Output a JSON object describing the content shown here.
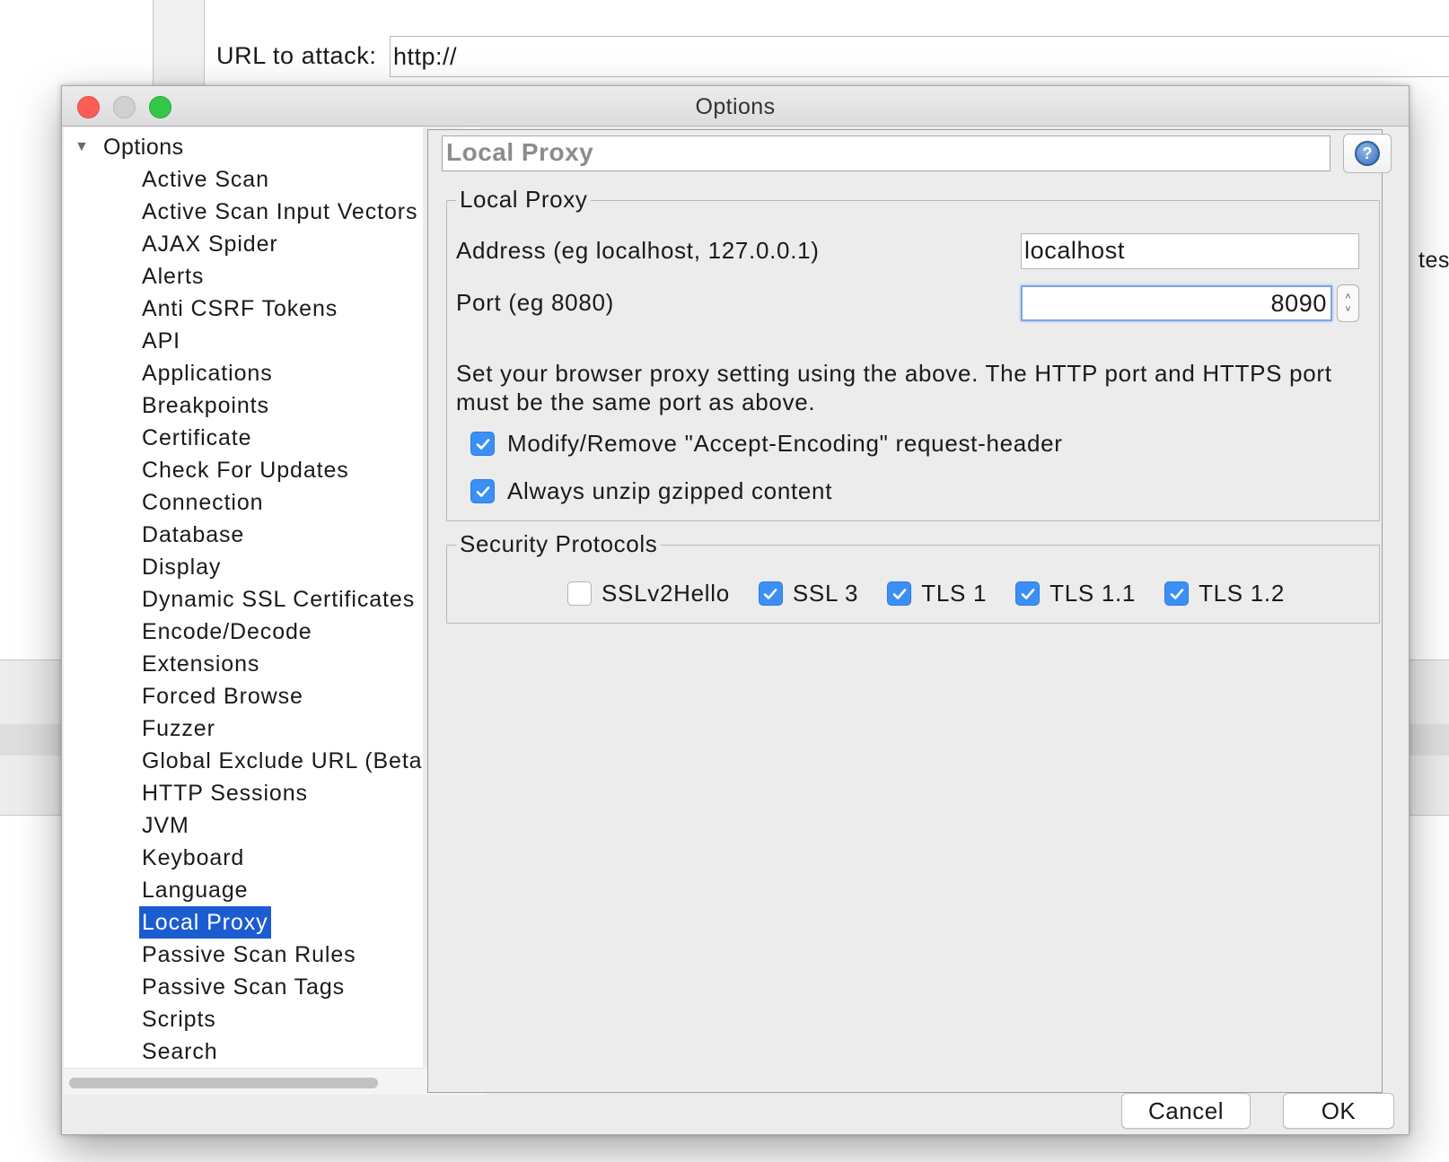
{
  "background": {
    "url_label": "URL to attack:",
    "url_value": "http://",
    "side_text": "tes"
  },
  "dialog": {
    "title": "Options",
    "tree": {
      "root_label": "Options",
      "items": [
        "Active Scan",
        "Active Scan Input Vectors",
        "AJAX Spider",
        "Alerts",
        "Anti CSRF Tokens",
        "API",
        "Applications",
        "Breakpoints",
        "Certificate",
        "Check For Updates",
        "Connection",
        "Database",
        "Display",
        "Dynamic SSL Certificates",
        "Encode/Decode",
        "Extensions",
        "Forced Browse",
        "Fuzzer",
        "Global Exclude URL (Beta",
        "HTTP Sessions",
        "JVM",
        "Keyboard",
        "Language",
        "Local Proxy",
        "Passive Scan Rules",
        "Passive Scan Tags",
        "Scripts",
        "Search"
      ],
      "selected": "Local Proxy"
    },
    "panel": {
      "header": "Local Proxy",
      "help_icon": "help-icon",
      "local_proxy": {
        "title": "Local Proxy",
        "address_label": "Address (eg localhost, 127.0.0.1)",
        "address_value": "localhost",
        "port_label": "Port (eg 8080)",
        "port_value": "8090",
        "info": "Set your browser proxy setting using the above. The HTTP port and HTTPS port must be the same port as above.",
        "modify_header_label": "Modify/Remove \"Accept-Encoding\" request-header",
        "modify_header_checked": true,
        "unzip_label": "Always unzip gzipped content",
        "unzip_checked": true
      },
      "security_protocols": {
        "title": "Security Protocols",
        "protocols": [
          {
            "label": "SSLv2Hello",
            "checked": false
          },
          {
            "label": "SSL 3",
            "checked": true
          },
          {
            "label": "TLS 1",
            "checked": true
          },
          {
            "label": "TLS 1.1",
            "checked": true
          },
          {
            "label": "TLS 1.2",
            "checked": true
          }
        ]
      }
    },
    "buttons": {
      "cancel": "Cancel",
      "ok": "OK"
    }
  },
  "colors": {
    "selection": "#1c5cd1",
    "checkbox_checked": "#3b8ff5",
    "close": "#fc5e57",
    "minimize": "#d0d0d0",
    "maximize": "#34c84a"
  }
}
